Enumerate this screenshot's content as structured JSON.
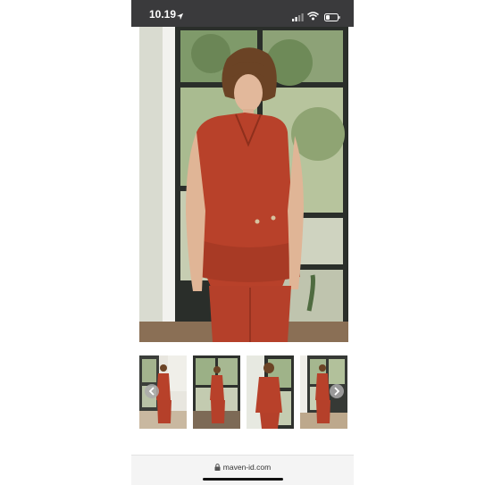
{
  "status_bar": {
    "time": "10.19",
    "icons": [
      "location-arrow-icon",
      "signal-bars-icon",
      "wifi-icon",
      "battery-icon"
    ]
  },
  "product_gallery": {
    "main_image": "model-in-rust-orange-sleeveless-peplum-vest-and-trousers",
    "thumbnails": [
      "model-full-outfit-front-view",
      "model-full-outfit-near-window",
      "model-vest-closeup",
      "model-full-outfit-side-view"
    ],
    "nav_icons": [
      "chevron-left-icon",
      "chevron-right-icon"
    ]
  },
  "browser": {
    "url": "maven-id.com"
  },
  "colors": {
    "status_bar": "#3a3a3c",
    "garment": "#b8412a",
    "url_bar": "#f4f4f4"
  }
}
